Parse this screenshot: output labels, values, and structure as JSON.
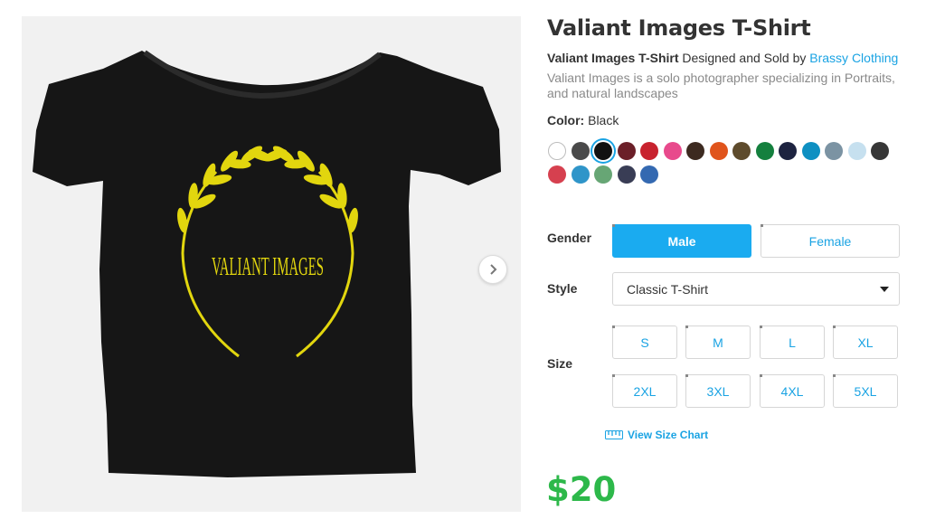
{
  "product": {
    "title": "Valiant Images T-Shirt",
    "byline_product": "Valiant Images T-Shirt",
    "byline_mid": " Designed and Sold by ",
    "seller": "Brassy Clothing",
    "description": "Valiant Images is a solo photographer specializing in Portraits, and natural landscapes",
    "color_label": "Color:",
    "color_value": "Black",
    "price": "$20",
    "design_text": "VALIANT IMAGES",
    "accent_color": "#1aabf0",
    "price_color": "#2db84a",
    "shirt_color": "#161616",
    "design_color": "#e2d60e"
  },
  "swatches": [
    {
      "name": "white",
      "color": "#ffffff"
    },
    {
      "name": "dark-gray",
      "color": "#4a4a4a"
    },
    {
      "name": "black",
      "color": "#111111",
      "selected": true
    },
    {
      "name": "maroon",
      "color": "#6b1f28"
    },
    {
      "name": "red",
      "color": "#c8222e"
    },
    {
      "name": "pink",
      "color": "#e84a8c"
    },
    {
      "name": "brown",
      "color": "#3d2a20"
    },
    {
      "name": "orange",
      "color": "#e0541c"
    },
    {
      "name": "olive-brown",
      "color": "#5e4b2c"
    },
    {
      "name": "green",
      "color": "#14803e"
    },
    {
      "name": "navy",
      "color": "#1d2340"
    },
    {
      "name": "teal-blue",
      "color": "#0e90c2"
    },
    {
      "name": "gray-blue",
      "color": "#7b93a3"
    },
    {
      "name": "light-blue",
      "color": "#c6e0ef"
    },
    {
      "name": "charcoal",
      "color": "#373737"
    },
    {
      "name": "heather-red",
      "color": "#d6404f"
    },
    {
      "name": "heather-blue",
      "color": "#2f95c9"
    },
    {
      "name": "heather-green",
      "color": "#67a675"
    },
    {
      "name": "heather-navy",
      "color": "#393d55"
    },
    {
      "name": "royal-blue",
      "color": "#3469b1"
    }
  ],
  "options": {
    "gender_label": "Gender",
    "gender": [
      "Male",
      "Female"
    ],
    "style_label": "Style",
    "style_value": "Classic T-Shirt",
    "size_label": "Size",
    "sizes": [
      "S",
      "M",
      "L",
      "XL",
      "2XL",
      "3XL",
      "4XL",
      "5XL"
    ],
    "size_chart": "View Size Chart"
  },
  "icons": {
    "next": "chevron-right-icon",
    "ruler": "ruler-icon",
    "caret": "caret-down-icon"
  }
}
